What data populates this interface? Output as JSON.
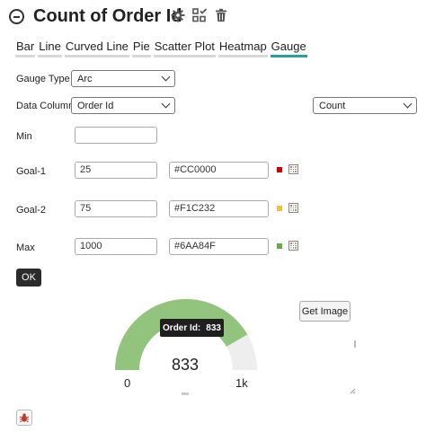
{
  "header": {
    "title": "Count of Order Id"
  },
  "tabs": [
    {
      "label": "Bar"
    },
    {
      "label": "Line"
    },
    {
      "label": "Curved Line"
    },
    {
      "label": "Pie"
    },
    {
      "label": "Scatter Plot"
    },
    {
      "label": "Heatmap"
    },
    {
      "label": "Gauge",
      "active": true
    }
  ],
  "form": {
    "gauge_type": {
      "label": "Gauge Type",
      "value": "Arc"
    },
    "data_column": {
      "label": "Data Column",
      "value": "Order Id",
      "aggregate": "Count"
    },
    "min": {
      "label": "Min",
      "value": ""
    },
    "goal1": {
      "label": "Goal-1",
      "value": "25",
      "color": "#CC0000"
    },
    "goal2": {
      "label": "Goal-2",
      "value": "75",
      "color": "#F1C232"
    },
    "max": {
      "label": "Max",
      "value": "1000",
      "color": "#6AA84F"
    }
  },
  "buttons": {
    "ok": "OK",
    "get_image": "Get Image"
  },
  "gauge": {
    "value_text": "833",
    "min_label": "0",
    "max_label": "1k",
    "fill_fraction": 0.833,
    "fill_color": "#93c47d",
    "track_color": "#eeeeee",
    "tooltip_key": "Order Id:",
    "tooltip_value": "833"
  }
}
